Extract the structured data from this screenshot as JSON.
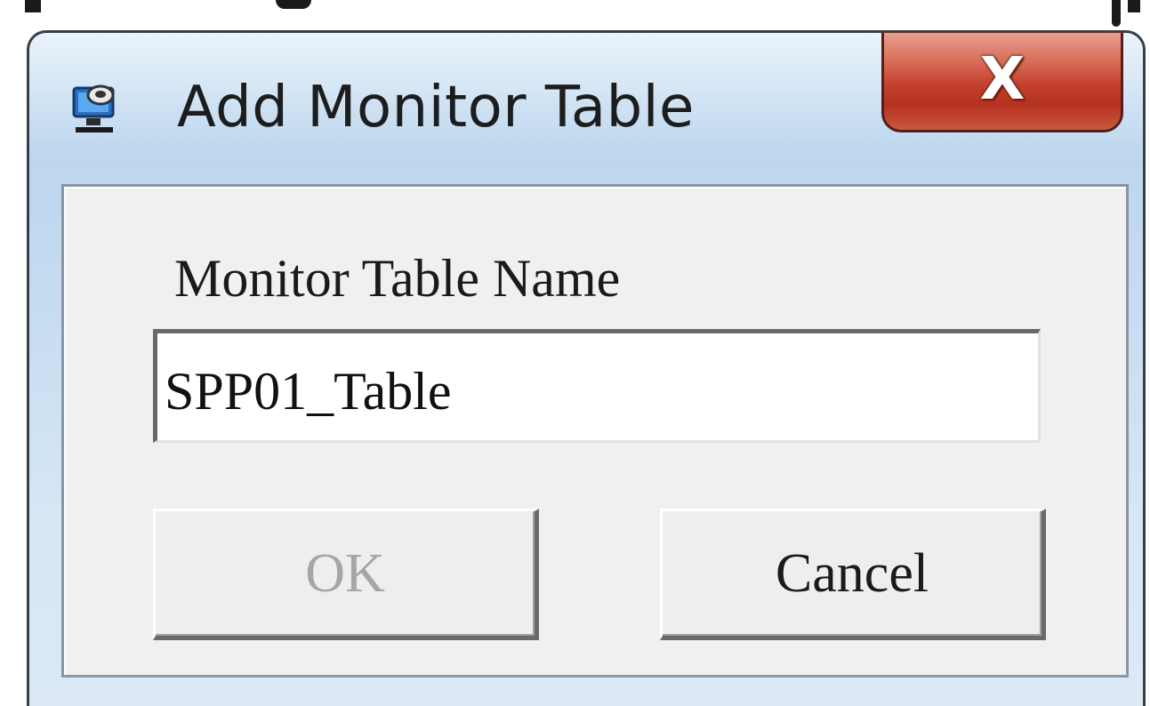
{
  "dialog": {
    "title": "Add Monitor Table",
    "close_glyph": "X",
    "icon": "monitor-icon"
  },
  "form": {
    "label": "Monitor Table Name",
    "value": "SPP01_Table"
  },
  "buttons": {
    "ok_label": "OK",
    "ok_enabled": false,
    "cancel_label": "Cancel"
  },
  "colors": {
    "titlebar": "#c6dcf1",
    "close_button": "#c3402c",
    "client_bg": "#f0f0f0",
    "disabled_text": "#a6a6a6"
  }
}
